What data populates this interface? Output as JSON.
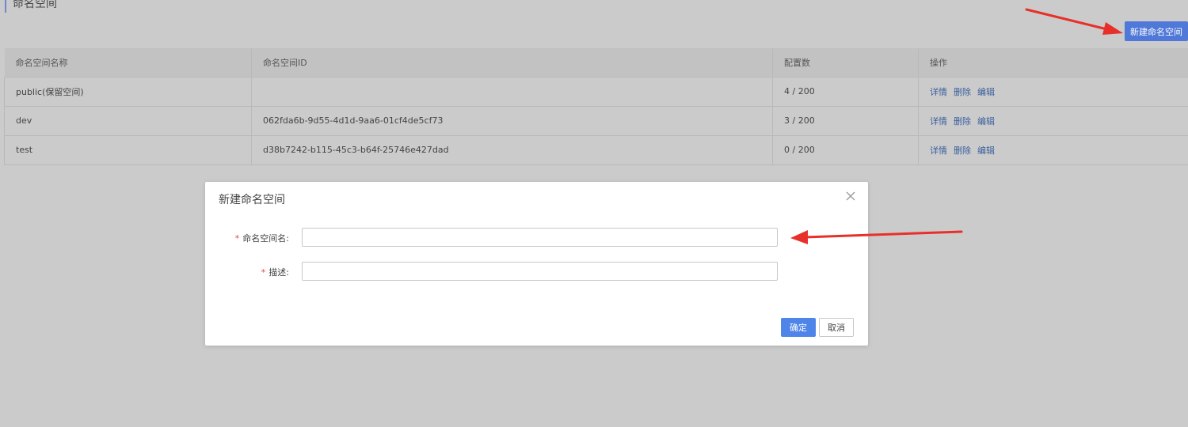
{
  "page": {
    "title": "命名空间"
  },
  "toolbar": {
    "new_button": "新建命名空间"
  },
  "table": {
    "headers": [
      "命名空间名称",
      "命名空间ID",
      "配置数",
      "操作"
    ],
    "rows": [
      {
        "name": "public(保留空间)",
        "id": "",
        "count": "4 / 200"
      },
      {
        "name": "dev",
        "id": "062fda6b-9d55-4d1d-9aa6-01cf4de5cf73",
        "count": "3 / 200"
      },
      {
        "name": "test",
        "id": "d38b7242-b115-45c3-b64f-25746e427dad",
        "count": "0 / 200"
      }
    ],
    "actions": {
      "detail": "详情",
      "delete": "删除",
      "edit": "编辑"
    }
  },
  "modal": {
    "title": "新建命名空间",
    "fields": {
      "name_label": "命名空间名:",
      "name_value": "",
      "desc_label": "描述:",
      "desc_value": "",
      "required_mark": "*"
    },
    "ok_label": "确定",
    "cancel_label": "取消"
  },
  "colors": {
    "accent": "#4f78d8",
    "annotation_arrow": "#e8302a",
    "required": "#e2473f"
  },
  "icons": {
    "close": "close-icon"
  }
}
